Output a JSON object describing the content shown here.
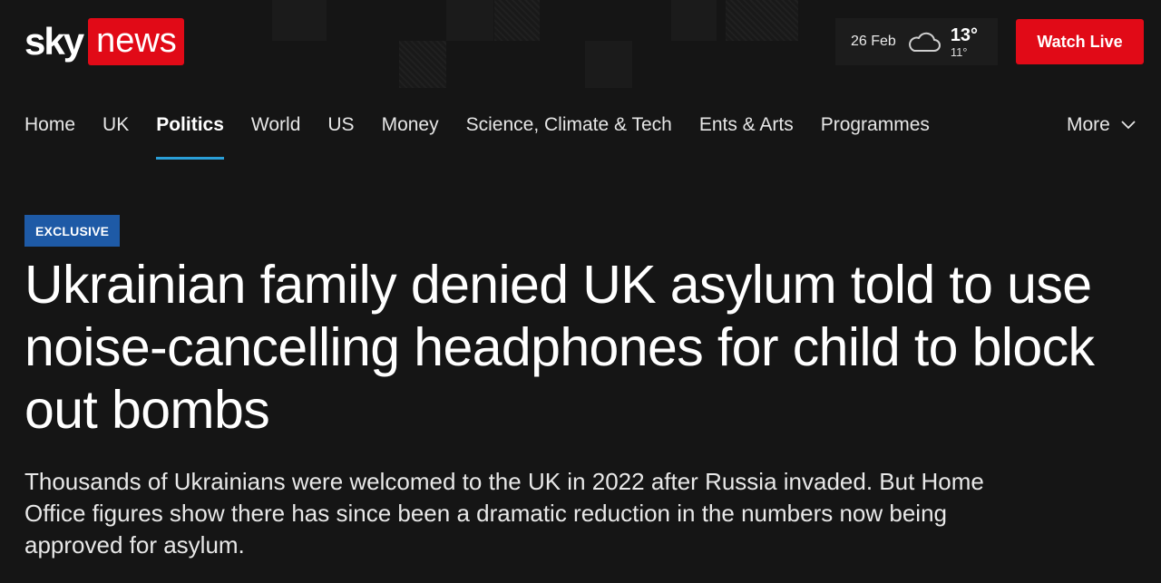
{
  "brand": {
    "sky": "sky",
    "news": "news"
  },
  "weather": {
    "date": "26 Feb",
    "high": "13°",
    "low": "11°",
    "icon": "cloud-icon"
  },
  "watch_live_label": "Watch Live",
  "nav": {
    "items": [
      {
        "label": "Home",
        "active": false
      },
      {
        "label": "UK",
        "active": false
      },
      {
        "label": "Politics",
        "active": true
      },
      {
        "label": "World",
        "active": false
      },
      {
        "label": "US",
        "active": false
      },
      {
        "label": "Money",
        "active": false
      },
      {
        "label": "Science, Climate & Tech",
        "active": false
      },
      {
        "label": "Ents & Arts",
        "active": false
      },
      {
        "label": "Programmes",
        "active": false
      }
    ],
    "more_label": "More"
  },
  "article": {
    "tag": "EXCLUSIVE",
    "headline": "Ukrainian family denied UK asylum told to use noise-cancelling headphones for child to block out bombs",
    "standfirst": "Thousands of Ukrainians were welcomed to the UK in 2022 after Russia invaded. But Home Office figures show there has since been a dramatic reduction in the numbers now being approved for asylum."
  },
  "colors": {
    "brand_red": "#e10a17",
    "accent_blue": "#2a9fd8",
    "tag_blue": "#1e5aa6",
    "background": "#151515"
  }
}
